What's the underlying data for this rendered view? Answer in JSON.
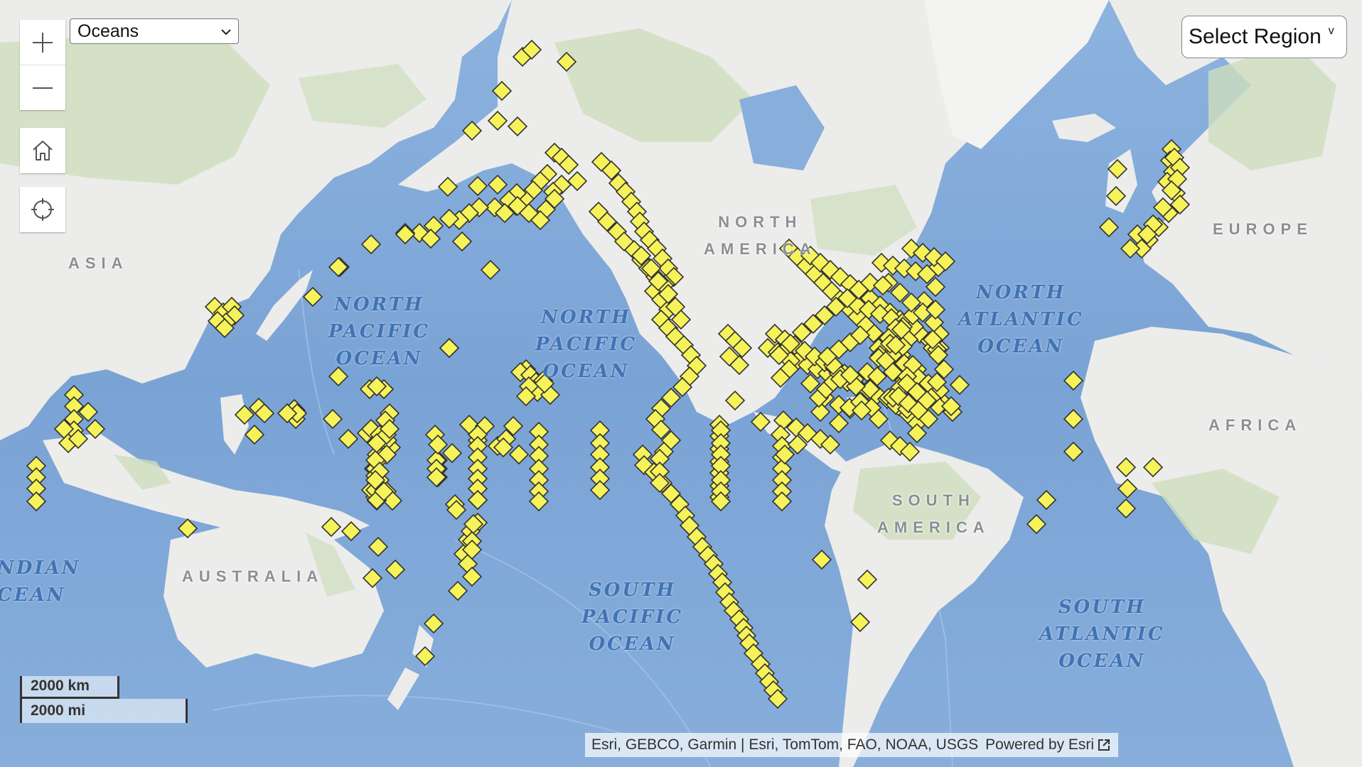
{
  "layer_select": {
    "selected": "Oceans"
  },
  "region_button": {
    "label": "Select Region",
    "caret": "v"
  },
  "scalebar": {
    "km_label": "2000 km",
    "mi_label": "2000 mi"
  },
  "attribution": {
    "sources": "Esri, GEBCO, Garmin | Esri, TomTom, FAO, NOAA, USGS",
    "powered_by": "Powered by Esri"
  },
  "ocean_labels": {
    "north_pacific_west": "NORTH\nPACIFIC\nOCEAN",
    "north_pacific_east": "NORTH\nPACIFIC\nOCEAN",
    "north_atlantic": "NORTH\nATLANTIC\nOCEAN",
    "south_pacific": "SOUTH\nPACIFIC\nOCEAN",
    "south_atlantic": "SOUTH\nATLANTIC\nOCEAN",
    "indian": "NDIAN\nCEAN"
  },
  "land_labels": {
    "asia": "ASIA",
    "north_america": "NORTH\nAMERICA",
    "europe": "EUROPE",
    "africa": "AFRICA",
    "south_america": "SOUTH\nAMERICA",
    "australia": "AUSTRALIA"
  },
  "icons": {
    "zoom_in": "plus-icon",
    "zoom_out": "minus-icon",
    "home": "home-icon",
    "locate": "locate-crosshair-icon",
    "external_link": "external-link-icon",
    "marker": "diamond-marker-icon"
  },
  "colors": {
    "ocean": "#7ea7d8",
    "land": "#ececea",
    "vegetation": "#c9dcb5",
    "marker_fill": "#f6f25a",
    "marker_stroke": "#333333",
    "ocean_label": "#3f74b5"
  }
}
